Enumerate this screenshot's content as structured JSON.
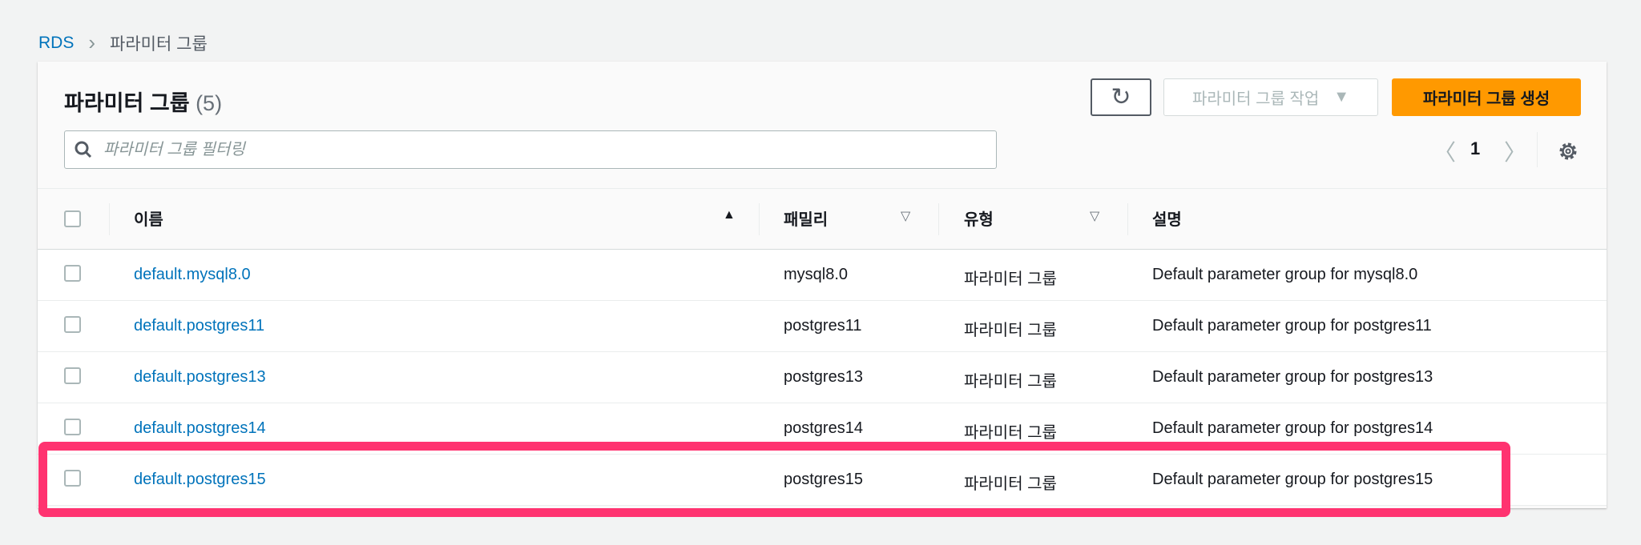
{
  "breadcrumb": {
    "root": "RDS",
    "current": "파라미터 그룹"
  },
  "header": {
    "title": "파라미터 그룹",
    "count": "(5)",
    "refresh_icon": "↻",
    "actions_label": "파라미터 그룹 작업",
    "create_label": "파라미터 그룹 생성"
  },
  "search": {
    "placeholder": "파라미터 그룹 필터링"
  },
  "pagination": {
    "page": "1"
  },
  "columns": {
    "name": "이름",
    "family": "패밀리",
    "type": "유형",
    "description": "설명"
  },
  "rows": [
    {
      "name": "default.mysql8.0",
      "family": "mysql8.0",
      "type": "파라미터 그룹",
      "description": "Default parameter group for mysql8.0"
    },
    {
      "name": "default.postgres11",
      "family": "postgres11",
      "type": "파라미터 그룹",
      "description": "Default parameter group for postgres11"
    },
    {
      "name": "default.postgres13",
      "family": "postgres13",
      "type": "파라미터 그룹",
      "description": "Default parameter group for postgres13"
    },
    {
      "name": "default.postgres14",
      "family": "postgres14",
      "type": "파라미터 그룹",
      "description": "Default parameter group for postgres14"
    },
    {
      "name": "default.postgres15",
      "family": "postgres15",
      "type": "파라미터 그룹",
      "description": "Default parameter group for postgres15"
    }
  ],
  "colors": {
    "accent": "#ff9900",
    "link": "#0073bb",
    "highlight": "#ff3370"
  }
}
